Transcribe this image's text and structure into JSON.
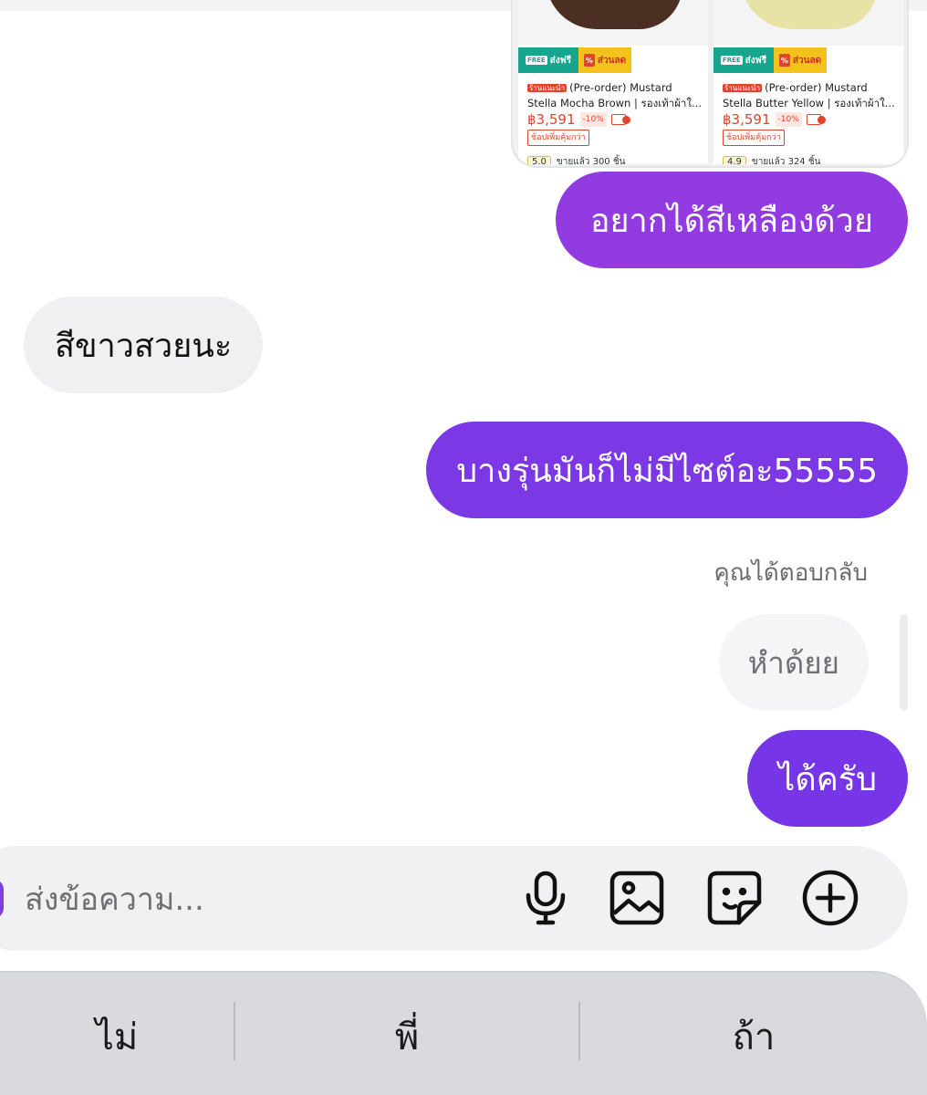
{
  "product_card": {
    "products": [
      {
        "badge_free": "FREE ส่งฟรี",
        "badge_discount": "ส่วนลด",
        "store_tag": "ร้านแนะนำ",
        "name_line1": "(Pre-order) Mustard",
        "name_line2": "Stella Mocha Brown | รองเท้าผ้าใ...",
        "price": "฿3,591",
        "discount": "-10%",
        "promo": "ช้อปเพิ่มคุ้มกว่า",
        "rating": "5.0",
        "sold": "ขายแล้ว 300 ชิ้น",
        "shoe_color": "#4a2f22"
      },
      {
        "badge_free": "FREE ส่งฟรี",
        "badge_discount": "ส่วนลด",
        "store_tag": "ร้านแนะนำ",
        "name_line1": "(Pre-order) Mustard",
        "name_line2": "Stella Butter Yellow | รองเท้าผ้าใ...",
        "price": "฿3,591",
        "discount": "-10%",
        "promo": "ช้อปเพิ่มคุ้มกว่า",
        "rating": "4.9",
        "sold": "ขายแล้ว 324 ชิ้น",
        "shoe_color": "#e9e2a6"
      }
    ]
  },
  "messages": [
    {
      "direction": "outgoing",
      "text": "อยากได้สีเหลืองด้วย"
    },
    {
      "direction": "incoming",
      "text": "สีขาวสวยนะ"
    },
    {
      "direction": "outgoing",
      "text": "บางรุ่นมันก็ไม่มีไซต์อะ55555"
    },
    {
      "direction": "outgoing",
      "text": "ได้ครับ"
    }
  ],
  "reply": {
    "label": "คุณได้ตอบกลับ",
    "quoted_text": "หำด้ยย"
  },
  "composer": {
    "placeholder": "ส่งข้อความ...",
    "icons": [
      "microphone-icon",
      "gallery-icon",
      "sticker-icon",
      "plus-circle-icon"
    ]
  },
  "keyboard": {
    "suggestions": [
      "ไม่",
      "พี่",
      "ถ้า"
    ]
  },
  "colors": {
    "outgoing_bubble": "#8a3ae2",
    "incoming_bubble": "#f0f0f2",
    "keyboard_bg": "#d9dadd"
  }
}
